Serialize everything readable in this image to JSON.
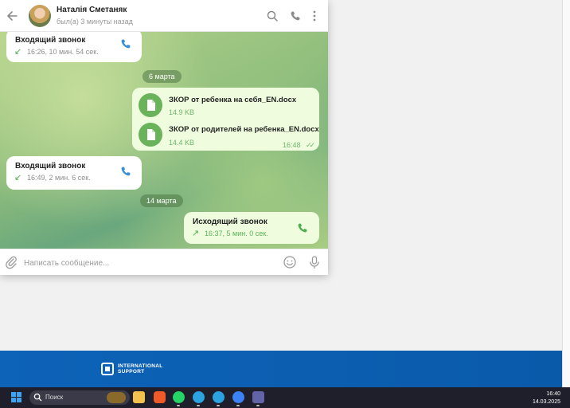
{
  "header": {
    "contact_name": "Наталія Сметаняк",
    "status": "был(а) 3 минуты назад",
    "icons": [
      "back-arrow-icon",
      "search-icon",
      "phone-icon",
      "more-vertical-icon"
    ]
  },
  "messages": {
    "call1": {
      "title": "Входящий звонок",
      "meta": "16:26, 10 мин. 54 сек."
    },
    "date1": "6 марта",
    "file1": {
      "name": "ЗКОР от ребенка на себя_EN.docx",
      "size": "14.9 KB"
    },
    "file2": {
      "name": "ЗКОР от родителей на ребенка_EN.docx",
      "size": "14.4 KB",
      "time": "16:48"
    },
    "call2": {
      "title": "Входящий звонок",
      "meta": "16:49, 2 мин. 6 сек."
    },
    "date2": "14 марта",
    "call3": {
      "title": "Исходящий звонок",
      "meta": "16:37, 5 мин. 0 сек."
    }
  },
  "composer": {
    "placeholder": "Написать сообщение..."
  },
  "banner": {
    "brand_line1": "INTERNATIONAL",
    "brand_line2": "SUPPORT"
  },
  "taskbar": {
    "search_label": "Поиск",
    "time": "16:40",
    "date": "14.03.2025",
    "apps": [
      "file-explorer-icon",
      "brave-browser-icon",
      "whatsapp-icon",
      "telegram-icon",
      "telegram-icon",
      "browser-icon",
      "teams-icon"
    ]
  },
  "colors": {
    "accent_blue": "#3a8fd6",
    "outgoing_bubble": "#effdde",
    "banner_blue": "#0d63b8",
    "taskbar": "#1f1f2b"
  }
}
